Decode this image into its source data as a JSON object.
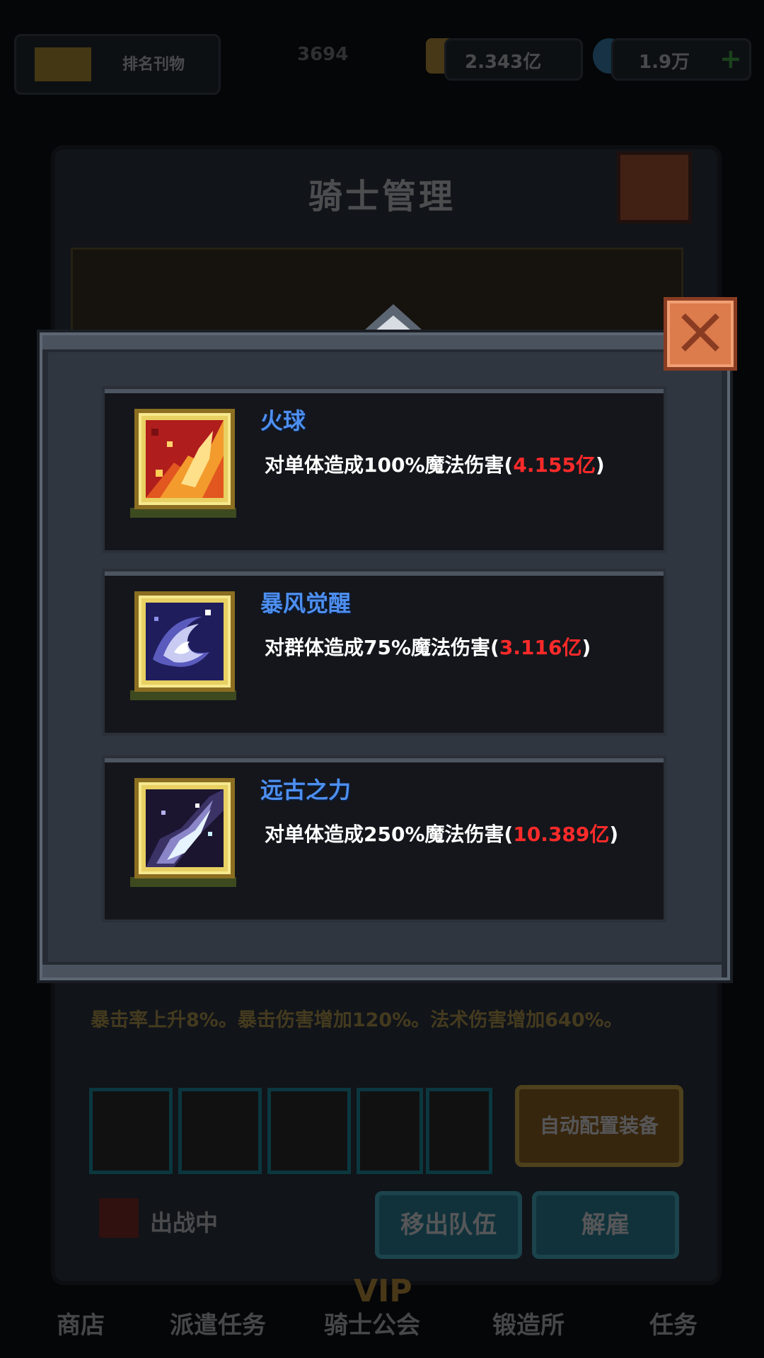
{
  "background": {
    "topbar": {
      "banner_text": "排名刊物",
      "rank_value": "3694",
      "gold_value": "2.343亿",
      "gem_value": "1.9万",
      "plus_label": "+"
    },
    "panel_title": "骑士管理",
    "description": "暴击率上升8%。暴击伤害增加120%。法术伤害增加640%。",
    "auto_equip_label": "自动配置装备",
    "remove_team_label": "移出队伍",
    "dismiss_label": "解雇",
    "status_label": "出战中",
    "nav": [
      "商店",
      "派遣任务",
      "骑士公会",
      "锻造所",
      "任务"
    ],
    "nav_vip": "VIP"
  },
  "skills": [
    {
      "name": "火球",
      "desc_prefix": "对单体造成",
      "percent": "100%",
      "desc_mid": "魔法伤害(",
      "damage": "4.155亿",
      "desc_suffix": ")",
      "icon": "fireball-icon"
    },
    {
      "name": "暴风觉醒",
      "desc_prefix": "对群体造成",
      "percent": "75%",
      "desc_mid": "魔法伤害(",
      "damage": "3.116亿",
      "desc_suffix": ")",
      "icon": "storm-awakening-icon"
    },
    {
      "name": "远古之力",
      "desc_prefix": "对单体造成",
      "percent": "250%",
      "desc_mid": "魔法伤害(",
      "damage": "10.389亿",
      "desc_suffix": ")",
      "icon": "ancient-power-icon"
    }
  ],
  "colors": {
    "skill_name": "#4d8ff0",
    "damage_value": "#ff2a2a",
    "close_button": "#dc7b4c",
    "icon_frame": "#e8d062"
  }
}
